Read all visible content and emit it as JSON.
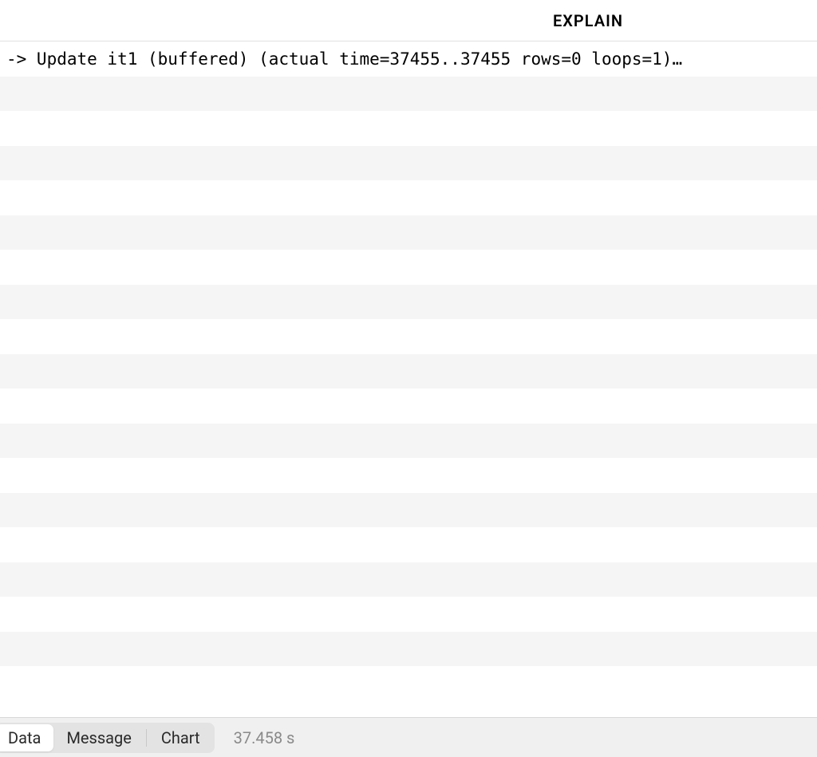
{
  "header": {
    "column_label": "EXPLAIN"
  },
  "results": {
    "rows": [
      "-> Update it1 (buffered)  (actual time=37455..37455 rows=0 loops=1)…",
      "",
      "",
      "",
      "",
      "",
      "",
      "",
      "",
      "",
      "",
      "",
      "",
      "",
      "",
      "",
      "",
      "",
      ""
    ]
  },
  "footer": {
    "tabs": {
      "data": "Data",
      "message": "Message",
      "chart": "Chart"
    },
    "elapsed": "37.458 s"
  }
}
